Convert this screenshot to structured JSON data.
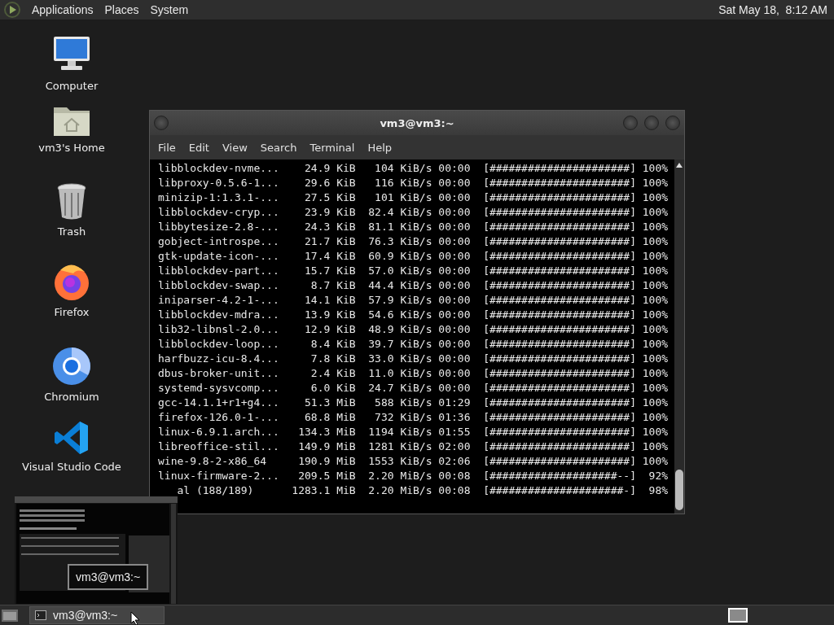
{
  "top_panel": {
    "menus": [
      {
        "label": "Applications"
      },
      {
        "label": "Places"
      },
      {
        "label": "System"
      }
    ],
    "clock": "Sat May 18,  8:12 AM"
  },
  "desktop_icons": [
    {
      "label": "Computer",
      "kind": "computer"
    },
    {
      "label": "vm3's Home",
      "kind": "home"
    },
    {
      "label": "Trash",
      "kind": "trash"
    },
    {
      "label": "Firefox",
      "kind": "firefox"
    },
    {
      "label": "Chromium",
      "kind": "chromium"
    },
    {
      "label": "Visual Studio Code",
      "kind": "vscode"
    }
  ],
  "terminal": {
    "title": "vm3@vm3:~",
    "menu": [
      "File",
      "Edit",
      "View",
      "Search",
      "Terminal",
      "Help"
    ],
    "rows": [
      {
        "name": "libblockdev-nvme...",
        "size": "24.9 KiB",
        "speed": "104 KiB/s",
        "eta": "00:00",
        "bar": "[######################]",
        "percent": "100%"
      },
      {
        "name": "libproxy-0.5.6-1...",
        "size": "29.6 KiB",
        "speed": "116 KiB/s",
        "eta": "00:00",
        "bar": "[######################]",
        "percent": "100%"
      },
      {
        "name": "minizip-1:1.3.1-...",
        "size": "27.5 KiB",
        "speed": "101 KiB/s",
        "eta": "00:00",
        "bar": "[######################]",
        "percent": "100%"
      },
      {
        "name": "libblockdev-cryp...",
        "size": "23.9 KiB",
        "speed": "82.4 KiB/s",
        "eta": "00:00",
        "bar": "[######################]",
        "percent": "100%"
      },
      {
        "name": "libbytesize-2.8-...",
        "size": "24.3 KiB",
        "speed": "81.1 KiB/s",
        "eta": "00:00",
        "bar": "[######################]",
        "percent": "100%"
      },
      {
        "name": "gobject-introspe...",
        "size": "21.7 KiB",
        "speed": "76.3 KiB/s",
        "eta": "00:00",
        "bar": "[######################]",
        "percent": "100%"
      },
      {
        "name": "gtk-update-icon-...",
        "size": "17.4 KiB",
        "speed": "60.9 KiB/s",
        "eta": "00:00",
        "bar": "[######################]",
        "percent": "100%"
      },
      {
        "name": "libblockdev-part...",
        "size": "15.7 KiB",
        "speed": "57.0 KiB/s",
        "eta": "00:00",
        "bar": "[######################]",
        "percent": "100%"
      },
      {
        "name": "libblockdev-swap...",
        "size": "8.7 KiB",
        "speed": "44.4 KiB/s",
        "eta": "00:00",
        "bar": "[######################]",
        "percent": "100%"
      },
      {
        "name": "iniparser-4.2-1-...",
        "size": "14.1 KiB",
        "speed": "57.9 KiB/s",
        "eta": "00:00",
        "bar": "[######################]",
        "percent": "100%"
      },
      {
        "name": "libblockdev-mdra...",
        "size": "13.9 KiB",
        "speed": "54.6 KiB/s",
        "eta": "00:00",
        "bar": "[######################]",
        "percent": "100%"
      },
      {
        "name": "lib32-libnsl-2.0...",
        "size": "12.9 KiB",
        "speed": "48.9 KiB/s",
        "eta": "00:00",
        "bar": "[######################]",
        "percent": "100%"
      },
      {
        "name": "libblockdev-loop...",
        "size": "8.4 KiB",
        "speed": "39.7 KiB/s",
        "eta": "00:00",
        "bar": "[######################]",
        "percent": "100%"
      },
      {
        "name": "harfbuzz-icu-8.4...",
        "size": "7.8 KiB",
        "speed": "33.0 KiB/s",
        "eta": "00:00",
        "bar": "[######################]",
        "percent": "100%"
      },
      {
        "name": "dbus-broker-unit...",
        "size": "2.4 KiB",
        "speed": "11.0 KiB/s",
        "eta": "00:00",
        "bar": "[######################]",
        "percent": "100%"
      },
      {
        "name": "systemd-sysvcomp...",
        "size": "6.0 KiB",
        "speed": "24.7 KiB/s",
        "eta": "00:00",
        "bar": "[######################]",
        "percent": "100%"
      },
      {
        "name": "gcc-14.1.1+r1+g4...",
        "size": "51.3 MiB",
        "speed": "588 KiB/s",
        "eta": "01:29",
        "bar": "[######################]",
        "percent": "100%"
      },
      {
        "name": "firefox-126.0-1-...",
        "size": "68.8 MiB",
        "speed": "732 KiB/s",
        "eta": "01:36",
        "bar": "[######################]",
        "percent": "100%"
      },
      {
        "name": "linux-6.9.1.arch...",
        "size": "134.3 MiB",
        "speed": "1194 KiB/s",
        "eta": "01:55",
        "bar": "[######################]",
        "percent": "100%"
      },
      {
        "name": "libreoffice-stil...",
        "size": "149.9 MiB",
        "speed": "1281 KiB/s",
        "eta": "02:00",
        "bar": "[######################]",
        "percent": "100%"
      },
      {
        "name": "wine-9.8-2-x86_64",
        "size": "190.9 MiB",
        "speed": "1553 KiB/s",
        "eta": "02:06",
        "bar": "[######################]",
        "percent": "100%"
      },
      {
        "name": "linux-firmware-2...",
        "size": "209.5 MiB",
        "speed": "2.20 MiB/s",
        "eta": "00:08",
        "bar": "[####################--]",
        "percent": "92%"
      },
      {
        "name": "al (188/189)",
        "size": "1283.1 MiB",
        "speed": "2.20 MiB/s",
        "eta": "00:08",
        "bar": "[#####################-]",
        "percent": "98%",
        "kind": "covered"
      }
    ]
  },
  "window_preview": {
    "tooltip": "vm3@vm3:~"
  },
  "taskbar": {
    "tasks": [
      {
        "label": "vm3@vm3:~"
      }
    ],
    "workspaces": [
      {
        "selected": true
      }
    ]
  }
}
